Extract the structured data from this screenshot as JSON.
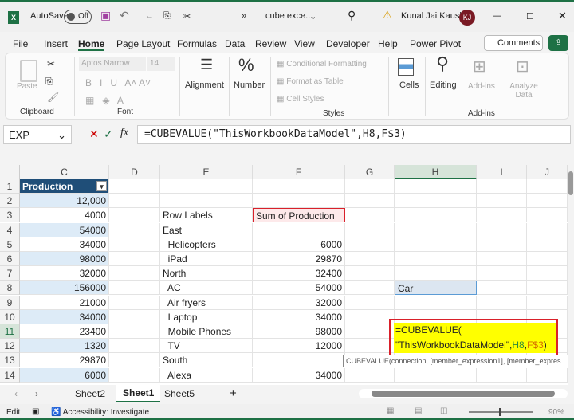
{
  "titlebar": {
    "autosave": "AutoSave",
    "toggle": "Off",
    "filename": "cube exce...",
    "user": "Kunal Jai Kaushik",
    "initials": "KJ"
  },
  "tabs": [
    "File",
    "Insert",
    "Home",
    "Page Layout",
    "Formulas",
    "Data",
    "Review",
    "View",
    "Developer",
    "Help",
    "Power Pivot"
  ],
  "active_tab": "Home",
  "comments": "Comments",
  "ribbon": {
    "paste": "Paste",
    "clipboard": "Clipboard",
    "font_name": "Aptos Narrow",
    "font_size": "14",
    "font": "Font",
    "alignment": "Alignment",
    "number": "Number",
    "cond_fmt": "Conditional Formatting",
    "fmt_table": "Format as Table",
    "cell_styles": "Cell Styles",
    "styles": "Styles",
    "cells": "Cells",
    "editing": "Editing",
    "addins": "Add-ins",
    "addins_group": "Add-ins",
    "analyze": "Analyze Data"
  },
  "namebox": "EXP",
  "formula": "=CUBEVALUE(\"ThisWorkbookDataModel\",H8,F$3)",
  "columns": [
    "C",
    "D",
    "E",
    "F",
    "G",
    "H",
    "I",
    "J"
  ],
  "rows": [
    {
      "n": "1",
      "C": "Production"
    },
    {
      "n": "2",
      "C": "12,000"
    },
    {
      "n": "3",
      "C": "4000",
      "E": "Row Labels",
      "F": "Sum of Production"
    },
    {
      "n": "4",
      "C": "54000",
      "E": "East"
    },
    {
      "n": "5",
      "C": "34000",
      "E": "  Helicopters",
      "F": "6000"
    },
    {
      "n": "6",
      "C": "98000",
      "E": "  iPad",
      "F": "29870"
    },
    {
      "n": "7",
      "C": "32000",
      "E": "North",
      "F": "32400"
    },
    {
      "n": "8",
      "C": "156000",
      "E": "  AC",
      "F": "54000",
      "H": "Car"
    },
    {
      "n": "9",
      "C": "21000",
      "E": "  Air fryers",
      "F": "32000"
    },
    {
      "n": "10",
      "C": "34000",
      "E": "  Laptop",
      "F": "34000"
    },
    {
      "n": "11",
      "C": "23400",
      "E": "  Mobile Phones",
      "F": "98000"
    },
    {
      "n": "12",
      "C": "1320",
      "E": "  TV",
      "F": "12000"
    },
    {
      "n": "13",
      "C": "29870",
      "E": "South"
    },
    {
      "n": "14",
      "C": "6000",
      "E": "  Alexa",
      "F": "34000"
    }
  ],
  "edit": {
    "line1": "=CUBEVALUE(",
    "str": "\"ThisWorkbookDataModel\"",
    "ref1": "H8",
    "ref2": "F$3",
    "tooltip": "CUBEVALUE(connection, [member_expression1], [member_expres"
  },
  "sheets": [
    "Sheet2",
    "Sheet1",
    "Sheet5"
  ],
  "active_sheet": "Sheet1",
  "status": {
    "mode": "Edit",
    "accessibility": "Accessibility: Investigate",
    "zoom": "90%"
  },
  "colors": {
    "accent": "#1e7145",
    "table_header": "#1f4e78",
    "band": "#ddebf7",
    "highlight": "#ffff00",
    "box": "#d9202a"
  }
}
